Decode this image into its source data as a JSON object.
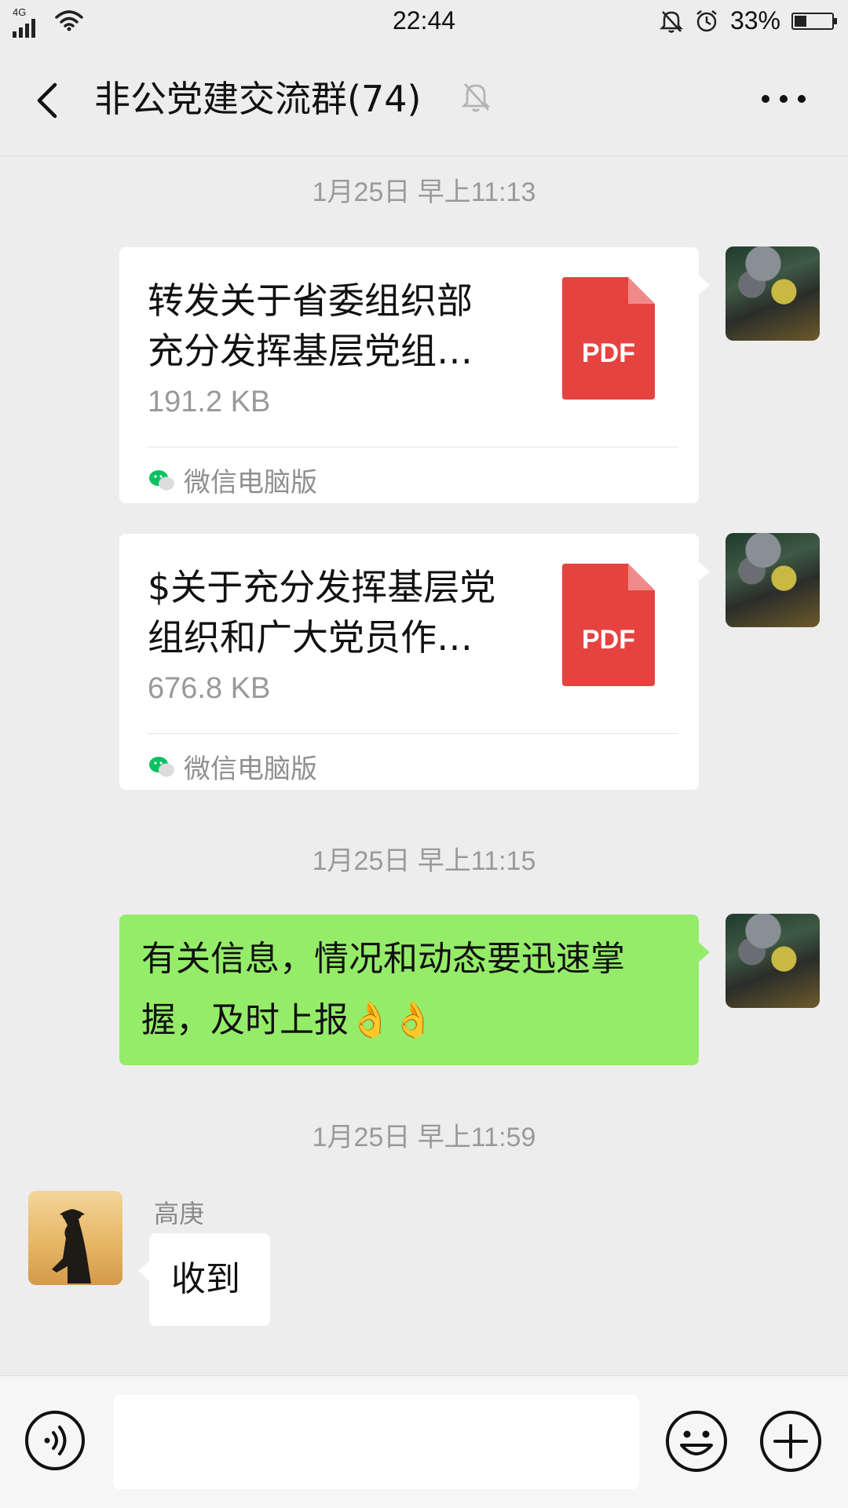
{
  "status_bar": {
    "network": "4G",
    "time": "22:44",
    "battery": "33%",
    "battery_level": 0.33
  },
  "header": {
    "title": "非公党建交流群(74)"
  },
  "messages": [
    {
      "type": "timestamp",
      "text": "1月25日 早上11:13"
    },
    {
      "type": "file",
      "name": "转发关于省委组织部\n充分发挥基层党组…",
      "size": "191.2 KB",
      "file_type": "PDF",
      "source": "微信电脑版"
    },
    {
      "type": "file",
      "name": "$关于充分发挥基层党\n组织和广大党员作…",
      "size": "676.8 KB",
      "file_type": "PDF",
      "source": "微信电脑版"
    },
    {
      "type": "timestamp",
      "text": "1月25日 早上11:15"
    },
    {
      "type": "text",
      "text": "有关信息，情况和动态要迅速掌握，及时上报👌👌"
    },
    {
      "type": "timestamp",
      "text": "1月25日 早上11:59"
    },
    {
      "type": "text",
      "sender": "高庚",
      "text": "收到"
    }
  ],
  "colors": {
    "background": "#ededed",
    "self_bubble": "#95ec69",
    "pdf_red": "#e64340",
    "wechat_green": "#07c160"
  },
  "icons": {
    "back": "back-arrow-icon",
    "mute": "bell-muted-icon",
    "more": "more-dots-icon",
    "voice": "voice-icon",
    "emoji": "emoji-icon",
    "plus": "plus-icon"
  }
}
